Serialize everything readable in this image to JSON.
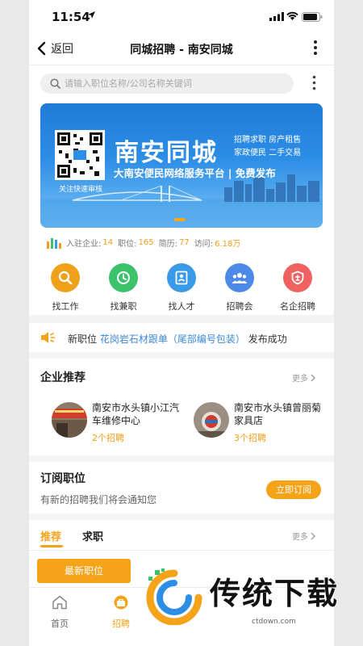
{
  "status_bar": {
    "time": "11:54"
  },
  "nav": {
    "back_label": "返回",
    "title": "同城招聘 - 南安同城"
  },
  "search": {
    "placeholder": "请输入职位名称/公司名称关键词"
  },
  "banner": {
    "qr_caption": "关注快速审核",
    "brand": "南安同城",
    "tag_line_1": "招聘求职  房产租售",
    "tag_line_2": "家政便民  二手交易",
    "slogan": "大南安便民网络服务平台 | 免费发布"
  },
  "stats": {
    "companies_label": "入驻企业:",
    "companies_value": "14",
    "jobs_label": "职位:",
    "jobs_value": "165",
    "resumes_label": "简历:",
    "resumes_value": "77",
    "visits_label": "访问:",
    "visits_value": "6.18万"
  },
  "categories": [
    {
      "label": "找工作",
      "icon": "search-icon",
      "color": "#f0a11c"
    },
    {
      "label": "找兼职",
      "icon": "clock-icon",
      "color": "#3cc26b"
    },
    {
      "label": "找人才",
      "icon": "resume-icon",
      "color": "#3b9ae8"
    },
    {
      "label": "招聘会",
      "icon": "people-icon",
      "color": "#4d8ae8"
    },
    {
      "label": "名企招聘",
      "icon": "enterprise-icon",
      "color": "#f06262"
    }
  ],
  "notice": {
    "prefix": "新职位",
    "highlight": "花岗岩石材跟单（尾部编号包装）",
    "suffix": "发布成功"
  },
  "company_section": {
    "title": "企业推荐",
    "more": "更多",
    "items": [
      {
        "name": "南安市水头镇小江汽车维修中心",
        "count": "2个招聘"
      },
      {
        "name": "南安市水头镇曾丽菊家具店",
        "count": "3个招聘"
      }
    ]
  },
  "subscribe": {
    "title": "订阅职位",
    "desc": "有新的招聘我们将会通知您",
    "button": "立即订阅"
  },
  "tabs": {
    "recommend": "推荐",
    "seeking": "求职",
    "more": "更多"
  },
  "newest_button": "最新职位",
  "tabbar": {
    "home": "首页",
    "jobs": "招聘"
  },
  "watermark": {
    "text": "传统下载",
    "url": "ctdown.com"
  },
  "colors": {
    "accent": "#f5a319",
    "link": "#3c8ad8",
    "banner": "#2d8ee6"
  }
}
